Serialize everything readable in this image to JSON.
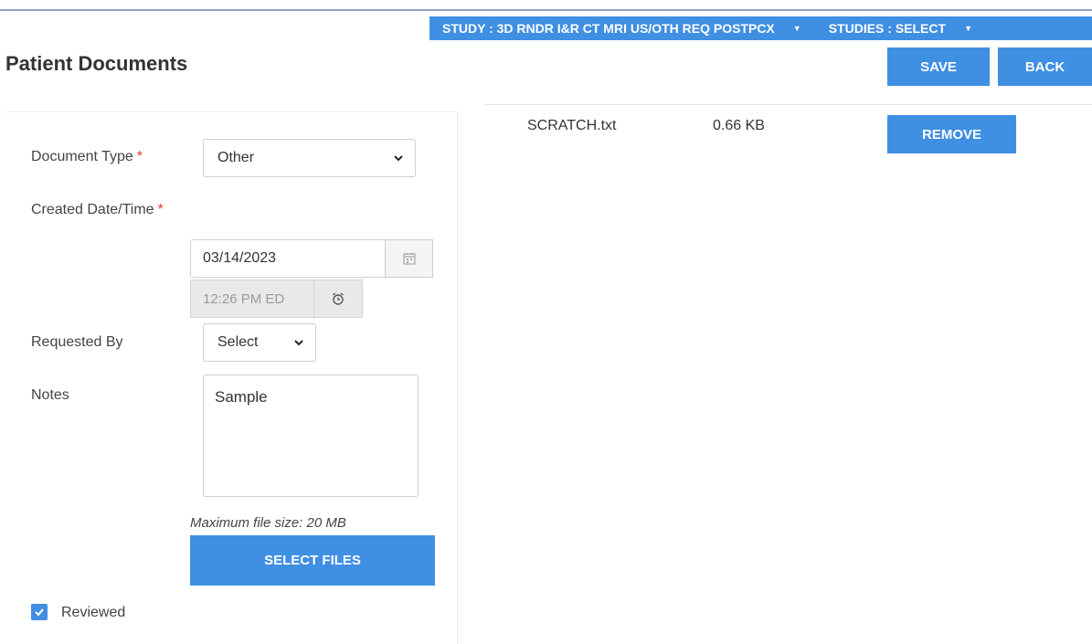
{
  "header": {
    "study_label": "STUDY : 3D RNDR I&R CT MRI US/OTH REQ POSTPCX",
    "studies_label": "STUDIES : SELECT",
    "title": "Patient Documents",
    "save_label": "SAVE",
    "back_label": "BACK"
  },
  "form": {
    "document_type": {
      "label": "Document Type",
      "required_mark": "*",
      "value": "Other"
    },
    "created": {
      "label": "Created Date/Time",
      "required_mark": "*",
      "date": "03/14/2023",
      "time": "12:26 PM ED"
    },
    "requested_by": {
      "label": "Requested By",
      "value": "Select"
    },
    "notes": {
      "label": "Notes",
      "value": "Sample"
    },
    "max_file_size": "Maximum file size: 20 MB",
    "select_files_label": "SELECT FILES",
    "reviewed": {
      "label": "Reviewed",
      "checked": true
    }
  },
  "files": [
    {
      "name": "SCRATCH.txt",
      "size": "0.66 KB",
      "remove_label": "REMOVE"
    }
  ],
  "colors": {
    "accent": "#3f8fe3",
    "required": "#e53935",
    "disabled_bg": "#e9e9e9"
  },
  "icons": {
    "dropdown": "caret-down-icon",
    "select": "chevron-down-icon",
    "date": "calendar-icon",
    "time": "alarm-clock-icon",
    "checkbox": "checkmark-icon"
  }
}
